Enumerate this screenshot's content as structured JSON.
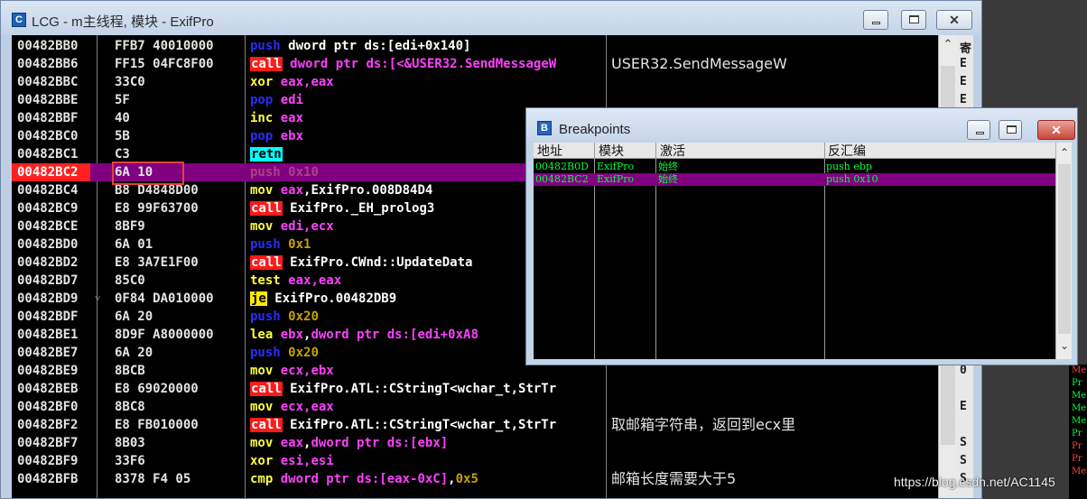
{
  "window": {
    "title": "LCG - m主线程, 模块 - ExifPro",
    "icon_letter": "C"
  },
  "cpu": {
    "rows": [
      {
        "addr": "00482BB0",
        "hex": "FFB7 40010000",
        "mn": "push",
        "mnc": "push",
        "ops": [
          [
            "dword ptr ds:[edi+0x140]",
            "str"
          ]
        ],
        "comment": ""
      },
      {
        "addr": "00482BB6",
        "hex": "FF15 04FC8F00",
        "mn": "call",
        "mnc": "call",
        "ops": [
          [
            "dword ptr ds:[<&USER32.SendMessageW",
            "reg"
          ]
        ],
        "comment": "USER32.SendMessageW"
      },
      {
        "addr": "00482BBC",
        "hex": "33C0",
        "mn": "xor",
        "mnc": "norm",
        "ops": [
          [
            "eax,eax",
            "reg"
          ]
        ],
        "comment": ""
      },
      {
        "addr": "00482BBE",
        "hex": "5F",
        "mn": "pop",
        "mnc": "pop",
        "ops": [
          [
            "edi",
            "reg"
          ]
        ],
        "comment": ""
      },
      {
        "addr": "00482BBF",
        "hex": "40",
        "mn": "inc",
        "mnc": "norm",
        "ops": [
          [
            "eax",
            "reg"
          ]
        ],
        "comment": ""
      },
      {
        "addr": "00482BC0",
        "hex": "5B",
        "mn": "pop",
        "mnc": "pop",
        "ops": [
          [
            "ebx",
            "reg"
          ]
        ],
        "comment": ""
      },
      {
        "addr": "00482BC1",
        "hex": "C3",
        "mn": "retn",
        "mnc": "retn",
        "ops": [],
        "comment": ""
      },
      {
        "addr": "00482BC2",
        "hex": "6A 10",
        "mn": "push",
        "mnc": "push",
        "ops": [
          [
            "0x10",
            "num"
          ]
        ],
        "comment": "",
        "selected": true
      },
      {
        "addr": "00482BC4",
        "hex": "B8 D4848D00",
        "mn": "mov",
        "mnc": "norm",
        "ops": [
          [
            "eax",
            "reg"
          ],
          [
            ",ExifPro.008D84D4",
            "sym"
          ]
        ],
        "comment": ""
      },
      {
        "addr": "00482BC9",
        "hex": "E8 99F63700",
        "mn": "call",
        "mnc": "call",
        "ops": [
          [
            "ExifPro._EH_prolog3",
            "sym"
          ]
        ],
        "comment": ""
      },
      {
        "addr": "00482BCE",
        "hex": "8BF9",
        "mn": "mov",
        "mnc": "norm",
        "ops": [
          [
            "edi,ecx",
            "reg"
          ]
        ],
        "comment": ""
      },
      {
        "addr": "00482BD0",
        "hex": "6A 01",
        "mn": "push",
        "mnc": "push",
        "ops": [
          [
            "0x1",
            "num"
          ]
        ],
        "comment": ""
      },
      {
        "addr": "00482BD2",
        "hex": "E8 3A7E1F00",
        "mn": "call",
        "mnc": "call",
        "ops": [
          [
            "ExifPro.CWnd::UpdateData",
            "sym"
          ]
        ],
        "comment": ""
      },
      {
        "addr": "00482BD7",
        "hex": "85C0",
        "mn": "test",
        "mnc": "norm",
        "ops": [
          [
            "eax,eax",
            "reg"
          ]
        ],
        "comment": ""
      },
      {
        "addr": "00482BD9",
        "hex": "0F84 DA010000",
        "mn": "je",
        "mnc": "je",
        "ops": [
          [
            "ExifPro.00482DB9",
            "sym"
          ]
        ],
        "comment": "",
        "arrow": "˅"
      },
      {
        "addr": "00482BDF",
        "hex": "6A 20",
        "mn": "push",
        "mnc": "push",
        "ops": [
          [
            "0x20",
            "num"
          ]
        ],
        "comment": ""
      },
      {
        "addr": "00482BE1",
        "hex": "8D9F A8000000",
        "mn": "lea",
        "mnc": "norm",
        "ops": [
          [
            "ebx",
            "reg"
          ],
          [
            ",",
            "sym"
          ],
          [
            "dword ptr ds:[edi+0xA8",
            "reg"
          ]
        ],
        "comment": ""
      },
      {
        "addr": "00482BE7",
        "hex": "6A 20",
        "mn": "push",
        "mnc": "push",
        "ops": [
          [
            "0x20",
            "num"
          ]
        ],
        "comment": ""
      },
      {
        "addr": "00482BE9",
        "hex": "8BCB",
        "mn": "mov",
        "mnc": "norm",
        "ops": [
          [
            "ecx,ebx",
            "reg"
          ]
        ],
        "comment": ""
      },
      {
        "addr": "00482BEB",
        "hex": "E8 69020000",
        "mn": "call",
        "mnc": "call",
        "ops": [
          [
            "ExifPro.ATL::CStringT<wchar_t,StrTr",
            "sym"
          ]
        ],
        "comment": ""
      },
      {
        "addr": "00482BF0",
        "hex": "8BC8",
        "mn": "mov",
        "mnc": "norm",
        "ops": [
          [
            "ecx,eax",
            "reg"
          ]
        ],
        "comment": ""
      },
      {
        "addr": "00482BF2",
        "hex": "E8 FB010000",
        "mn": "call",
        "mnc": "call",
        "ops": [
          [
            "ExifPro.ATL::CStringT<wchar_t,StrTr",
            "sym"
          ]
        ],
        "comment": "取邮箱字符串，返回到ecx里"
      },
      {
        "addr": "00482BF7",
        "hex": "8B03",
        "mn": "mov",
        "mnc": "norm",
        "ops": [
          [
            "eax",
            "reg"
          ],
          [
            ",",
            "sym"
          ],
          [
            "dword ptr ds:[ebx]",
            "reg"
          ]
        ],
        "comment": ""
      },
      {
        "addr": "00482BF9",
        "hex": "33F6",
        "mn": "xor",
        "mnc": "norm",
        "ops": [
          [
            "esi,esi",
            "reg"
          ]
        ],
        "comment": ""
      },
      {
        "addr": "00482BFB",
        "hex": "8378 F4 05",
        "mn": "cmp",
        "mnc": "norm",
        "ops": [
          [
            "dword ptr ds:[eax-0xC]",
            "reg"
          ],
          [
            ",",
            "sym"
          ],
          [
            "0x5",
            "num"
          ]
        ],
        "comment": "邮箱长度需要大于5"
      }
    ],
    "register_strip": [
      "寄",
      "E",
      "E",
      "E",
      "",
      "",
      "",
      "",
      "",
      "",
      "",
      "",
      "",
      "",
      "",
      "",
      "",
      "",
      "0",
      "",
      "E",
      "",
      "S",
      "S",
      "S"
    ]
  },
  "breakpoints": {
    "title": "Breakpoints",
    "icon_letter": "B",
    "columns": [
      "地址",
      "模块",
      "激活",
      "反汇编"
    ],
    "rows": [
      {
        "addr": "00482B0D",
        "module": "ExifPro",
        "active": "始终",
        "disasm": "push ebp",
        "selected": false
      },
      {
        "addr": "00482BC2",
        "module": "ExifPro",
        "active": "始终",
        "disasm": "push 0x10",
        "selected": true
      }
    ]
  },
  "right_panel": {
    "lines": [
      "Me",
      "Pr",
      "Me",
      "Me",
      "Me",
      "Pr",
      "Pr",
      "Pr",
      "Me"
    ]
  },
  "watermark": "https://blog.csdn.net/AC1145",
  "colors": {
    "selected_row": "#800080",
    "breakpoint_addr": "#ff2020",
    "call_bg": "#ff1a1a",
    "je_bg": "#ffea00",
    "retn_bg": "#00ffff",
    "bp_text": "#00ff3a"
  }
}
